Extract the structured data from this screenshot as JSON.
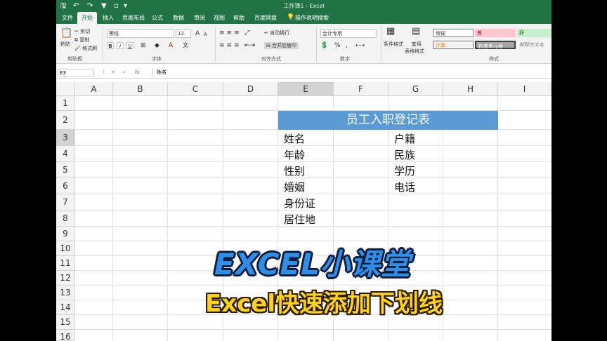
{
  "window": {
    "title": "工作簿1 - Excel"
  },
  "tabs": [
    "文件",
    "开始",
    "插入",
    "页面布局",
    "公式",
    "数据",
    "审阅",
    "视图",
    "帮助",
    "百度网盘",
    "操作说明搜索"
  ],
  "ribbon": {
    "clipboard": {
      "paste": "粘贴",
      "cut": "剪切",
      "copy": "复制",
      "format_painter": "格式刷",
      "label": "剪贴板"
    },
    "font": {
      "name": "等线",
      "size": "12",
      "grow": "A",
      "shrink": "A",
      "bold": "B",
      "italic": "I",
      "underline": "U",
      "font_color": "A",
      "phonetic": "文",
      "label": "字体"
    },
    "alignment": {
      "wrap": "自动换行",
      "merge": "合并后居中",
      "label": "对齐方式"
    },
    "number": {
      "format": "会计专用",
      "percent": "%",
      "comma": ",",
      "label": "数字"
    },
    "styles": {
      "conditional": "条件格式",
      "table_line1": "套用",
      "table_line2": "表格格式",
      "normal": "常规",
      "bad": "差",
      "good": "好",
      "calc": "计算",
      "check": "检查单元格",
      "explain": "解释性文本",
      "label": "样式"
    }
  },
  "formula_bar": {
    "name_box": "E3",
    "fx": "fx",
    "value": "姓名"
  },
  "columns": [
    "A",
    "B",
    "C",
    "D",
    "E",
    "F",
    "G",
    "H",
    "I"
  ],
  "rows": [
    "1",
    "2",
    "3",
    "4",
    "5",
    "6",
    "7",
    "8",
    "9",
    "10",
    "11",
    "12",
    "13",
    "14",
    "15",
    "16"
  ],
  "sheet": {
    "title": "员工入职登记表",
    "left_labels": [
      "姓名",
      "年龄",
      "性别",
      "婚姻",
      "身份证",
      "居住地"
    ],
    "right_labels": [
      "户籍",
      "民族",
      "学历",
      "电话"
    ]
  },
  "overlay": {
    "title": "EXCEL小课堂",
    "subtitle": "Excel快速添加下划线"
  },
  "colors": {
    "excel_green": "#217346",
    "header_fill": "#5b9bd5",
    "overlay_blue": "#2f8fe8",
    "overlay_yellow": "#ffd21c"
  }
}
